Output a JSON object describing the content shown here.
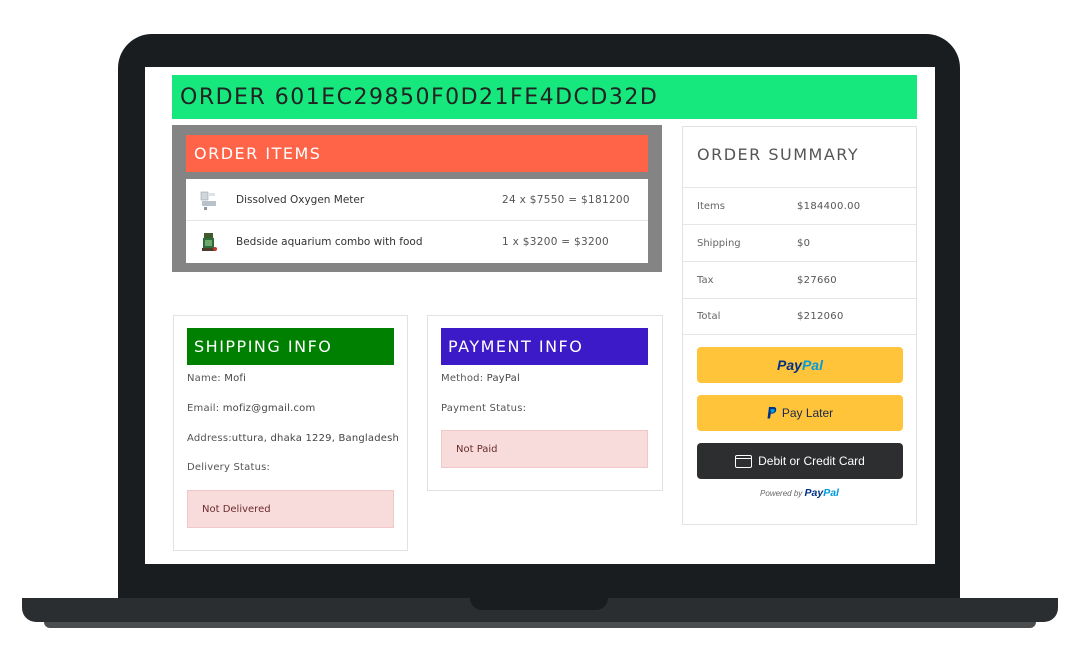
{
  "order": {
    "title": "ORDER 601EC29850F0D21FE4DCD32D"
  },
  "order_items": {
    "header": "ORDER ITEMS",
    "items": [
      {
        "name": "Dissolved Oxygen Meter",
        "calc": "24 x $7550 = $181200",
        "thumb_icon": "meter-thumbnail-icon"
      },
      {
        "name": "Bedside aquarium combo with food",
        "calc": "1 x $3200 = $3200",
        "thumb_icon": "aquarium-thumbnail-icon"
      }
    ]
  },
  "shipping": {
    "header": "SHIPPING INFO",
    "name_label": "Name:",
    "name_value": "Mofi",
    "email_label": "Email:",
    "email_value": "mofiz@gmail.com",
    "address_label": "Address:",
    "address_value": "uttura, dhaka 1229, Bangladesh",
    "delivery_label": "Delivery Status:",
    "delivery_status": "Not Delivered"
  },
  "payment": {
    "header": "PAYMENT INFO",
    "method_label": "Method:",
    "method_value": "PayPal",
    "status_label": "Payment Status:",
    "payment_status": "Not Paid"
  },
  "summary": {
    "title": "ORDER SUMMARY",
    "rows": [
      {
        "label": "Items",
        "value": "$184400.00"
      },
      {
        "label": "Shipping",
        "value": "$0"
      },
      {
        "label": "Tax",
        "value": "$27660"
      },
      {
        "label": "Total",
        "value": "$212060"
      }
    ]
  },
  "paypal": {
    "brand_pay": "Pay",
    "brand_pal": "Pal",
    "pay_later_label": "Pay Later",
    "card_label": "Debit or Credit Card",
    "powered_by": "Powered by"
  },
  "colors": {
    "title_bg": "#17e87d",
    "items_header_bg": "#ff6448",
    "shipping_header_bg": "#008000",
    "payment_header_bg": "#3d1ac7",
    "paypal_yellow": "#ffc43a",
    "card_button_bg": "#2c2e2f",
    "alert_bg": "#f8dcdc"
  }
}
